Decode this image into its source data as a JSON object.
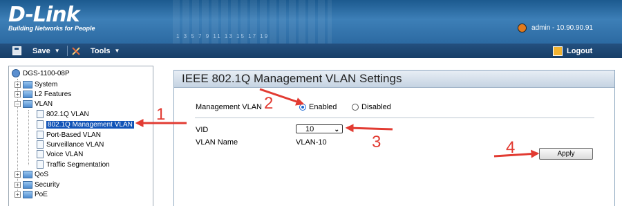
{
  "header": {
    "logo_text": "D-Link",
    "tagline": "Building Networks for People",
    "port_numbers": "1 3 5 7 9 11 13 15 17 19",
    "user": "admin - 10.90.90.91"
  },
  "menubar": {
    "save_label": "Save",
    "tools_label": "Tools",
    "logout_label": "Logout"
  },
  "tree": {
    "root": "DGS-1100-08P",
    "items": [
      {
        "label": "System"
      },
      {
        "label": "L2 Features"
      },
      {
        "label": "VLAN"
      },
      {
        "label": "802.1Q VLAN"
      },
      {
        "label": "802.1Q Management VLAN"
      },
      {
        "label": "Port-Based VLAN"
      },
      {
        "label": "Surveillance VLAN"
      },
      {
        "label": "Voice VLAN"
      },
      {
        "label": "Traffic Segmentation"
      },
      {
        "label": "QoS"
      },
      {
        "label": "Security"
      },
      {
        "label": "PoE"
      }
    ]
  },
  "panel": {
    "title": "IEEE 802.1Q Management VLAN Settings",
    "mgmt_vlan_label": "Management VLAN",
    "enabled_label": "Enabled",
    "disabled_label": "Disabled",
    "vid_label": "VID",
    "vid_value": "10",
    "vlan_name_label": "VLAN Name",
    "vlan_name_value": "VLAN-10",
    "apply_label": "Apply"
  },
  "annotations": [
    "1",
    "2",
    "3",
    "4"
  ],
  "colors": {
    "annotation": "#e23b32",
    "selection": "#1254b7",
    "header": "#2c6aa2"
  }
}
